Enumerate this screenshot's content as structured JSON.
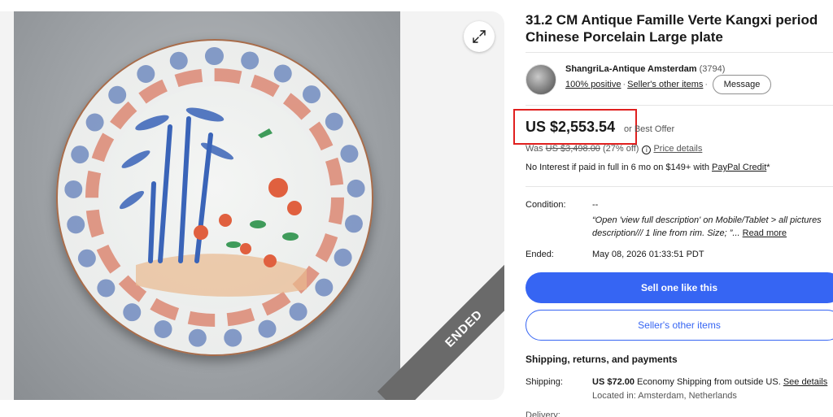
{
  "listing": {
    "title": "31.2 CM Antique Famille Verte Kangxi period Chinese Porcelain Large plate",
    "ended_label": "ENDED"
  },
  "icons": {
    "expand": "expand-icon",
    "info": "info-icon"
  },
  "seller": {
    "name": "ShangriLa-Antique Amsterdam",
    "count": "(3794)",
    "positive": "100% positive",
    "other_items": "Seller's other items",
    "message_label": "Message"
  },
  "price": {
    "amount": "US $2,553.54",
    "best_offer": "or Best Offer",
    "was_prefix": "Was",
    "was_amount": "US $3,498.00",
    "discount": "(27% off)",
    "details_link": "Price details",
    "credit_text": "No Interest if paid in full in 6 mo on $149+ with",
    "credit_link": "PayPal Credit",
    "credit_suffix": "*"
  },
  "details": {
    "condition_label": "Condition:",
    "condition_value": "--",
    "condition_quote": "“Open 'view full description' on Mobile/Tablet > all pictures description/// 1 line from rim. Size; ”...",
    "read_more": "Read more",
    "ended_label": "Ended:",
    "ended_value": "May 08, 2026 01:33:51 PDT"
  },
  "actions": {
    "sell_one": "Sell one like this",
    "seller_other": "Seller's other items"
  },
  "shipping": {
    "heading": "Shipping, returns, and payments",
    "label": "Shipping:",
    "price": "US $72.00",
    "method": "Economy Shipping from outside US.",
    "details_link": "See details",
    "location": "Located in: Amsterdam, Netherlands",
    "next_row_label": "Delivery:"
  },
  "colors": {
    "accent": "#3665f3",
    "highlight": "#e0201f"
  }
}
